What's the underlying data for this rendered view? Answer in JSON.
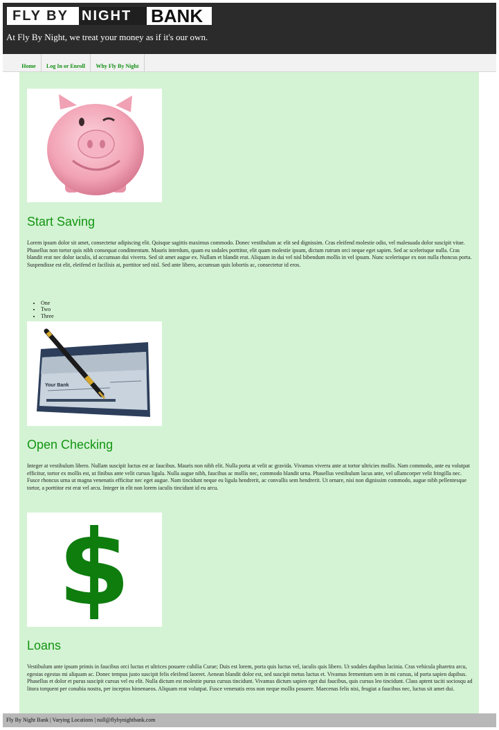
{
  "brand": {
    "logo_part1": "FLY BY",
    "logo_part2": "NIGHT",
    "logo_part3": "BANK",
    "tagline": "At Fly By Night, we treat your money as if it's our own."
  },
  "nav": {
    "items": [
      {
        "label": "Home"
      },
      {
        "label": "Log In or Enroll"
      },
      {
        "label": "Why Fly By Night"
      }
    ]
  },
  "sections": [
    {
      "title": "Start Saving",
      "image_icon": "piggy-bank-icon",
      "text": "Lorem ipsum dolor sit amet, consectetur adipiscing elit. Quisque sagittis maximus commodo. Donec vestibulum ac elit sed dignissim. Cras eleifend molestie odio, vel malesuada dolor suscipit vitae. Phasellus non tortor quis nibh consequat condimentum. Mauris interdum, quam eu sodales porttitor, elit quam molestie ipsum, dictum rutrum orci neque eget sapien. Sed ac scelerisque nulla. Cras blandit erat nec dolor iaculis, id accumsan dui viverra. Sed sit amet augue ex. Nullam et blandit erat. Aliquam in dui vel nisl bibendum mollis in vel ipsum. Nunc scelerisque ex non nulla rhoncus porta. Suspendisse est elit, eleifend et facilisis at, porttitor sed nisl. Sed ante libero, accumsan quis lobortis ac, consectetur id eros.",
      "list": [
        "One",
        "Two",
        "Three"
      ]
    },
    {
      "title": "Open Checking",
      "image_icon": "check-and-pen-icon",
      "check_bank_label": "Your Bank",
      "text": "Integer at vestibulum libero. Nullam suscipit luctus est ac faucibus. Mauris non nibh elit. Nulla porta at velit ac gravida. Vivamus viverra ante at tortor ultricies mollis. Nam commodo, ante eu volutpat efficitur, tortor ex mollis est, ut finibus ante velit cursus ligula. Nulla augue nibh, faucibus ac mollis nec, commodo blandit urna. Phasellus vestibulum lacus ante, vel ullamcorper velit fringilla nec. Fusce rhoncus urna ut magna venenatis efficitur nec eget augue. Nam tincidunt neque eu ligula hendrerit, ac convallis sem hendrerit. Ut ornare, nisi non dignissim commodo, augue nibh pellentesque tortor, a porttitor est erat vel arcu. Integer in elit non lorem iaculis tincidunt id eu arcu."
    },
    {
      "title": "Loans",
      "image_icon": "dollar-sign-icon",
      "text": "Vestibulum ante ipsum primis in faucibus orci luctus et ultrices posuere cubilia Curae; Duis est lorem, porta quis luctus vel, iaculis quis libero. Ut sodales dapibus lacinia. Cras vehicula pharetra arcu, egestas egestas mi aliquam ac. Donec tempus justo suscipit felis eleifend laoreet. Aenean blandit dolor est, sed suscipit metus luctus et. Vivamus fermentum sem in mi cursus, id porta sapien dapibus. Phasellus et dolor et purus suscipit cursus vel eu elit. Nulla dictum est molestie purus cursus tincidunt. Vivamus dictum sapien eget dui faucibus, quis cursus leo tincidunt. Class aptent taciti sociosqu ad litora torquent per conubia nostra, per inceptos himenaeos. Aliquam erat volutpat. Fusce venenatis eros non neque mollis posuere. Maecenas felis nisi, feugiat a faucibus nec, luctus sit amet dui."
    }
  ],
  "footer": {
    "text": "Fly By Night Bank | Varying Locations | null@flybynightbank.com"
  },
  "colors": {
    "header_bg": "#2b2b2b",
    "main_bg": "#d4f3d4",
    "accent_green": "#129512",
    "footer_bg": "#b8b8b8"
  }
}
